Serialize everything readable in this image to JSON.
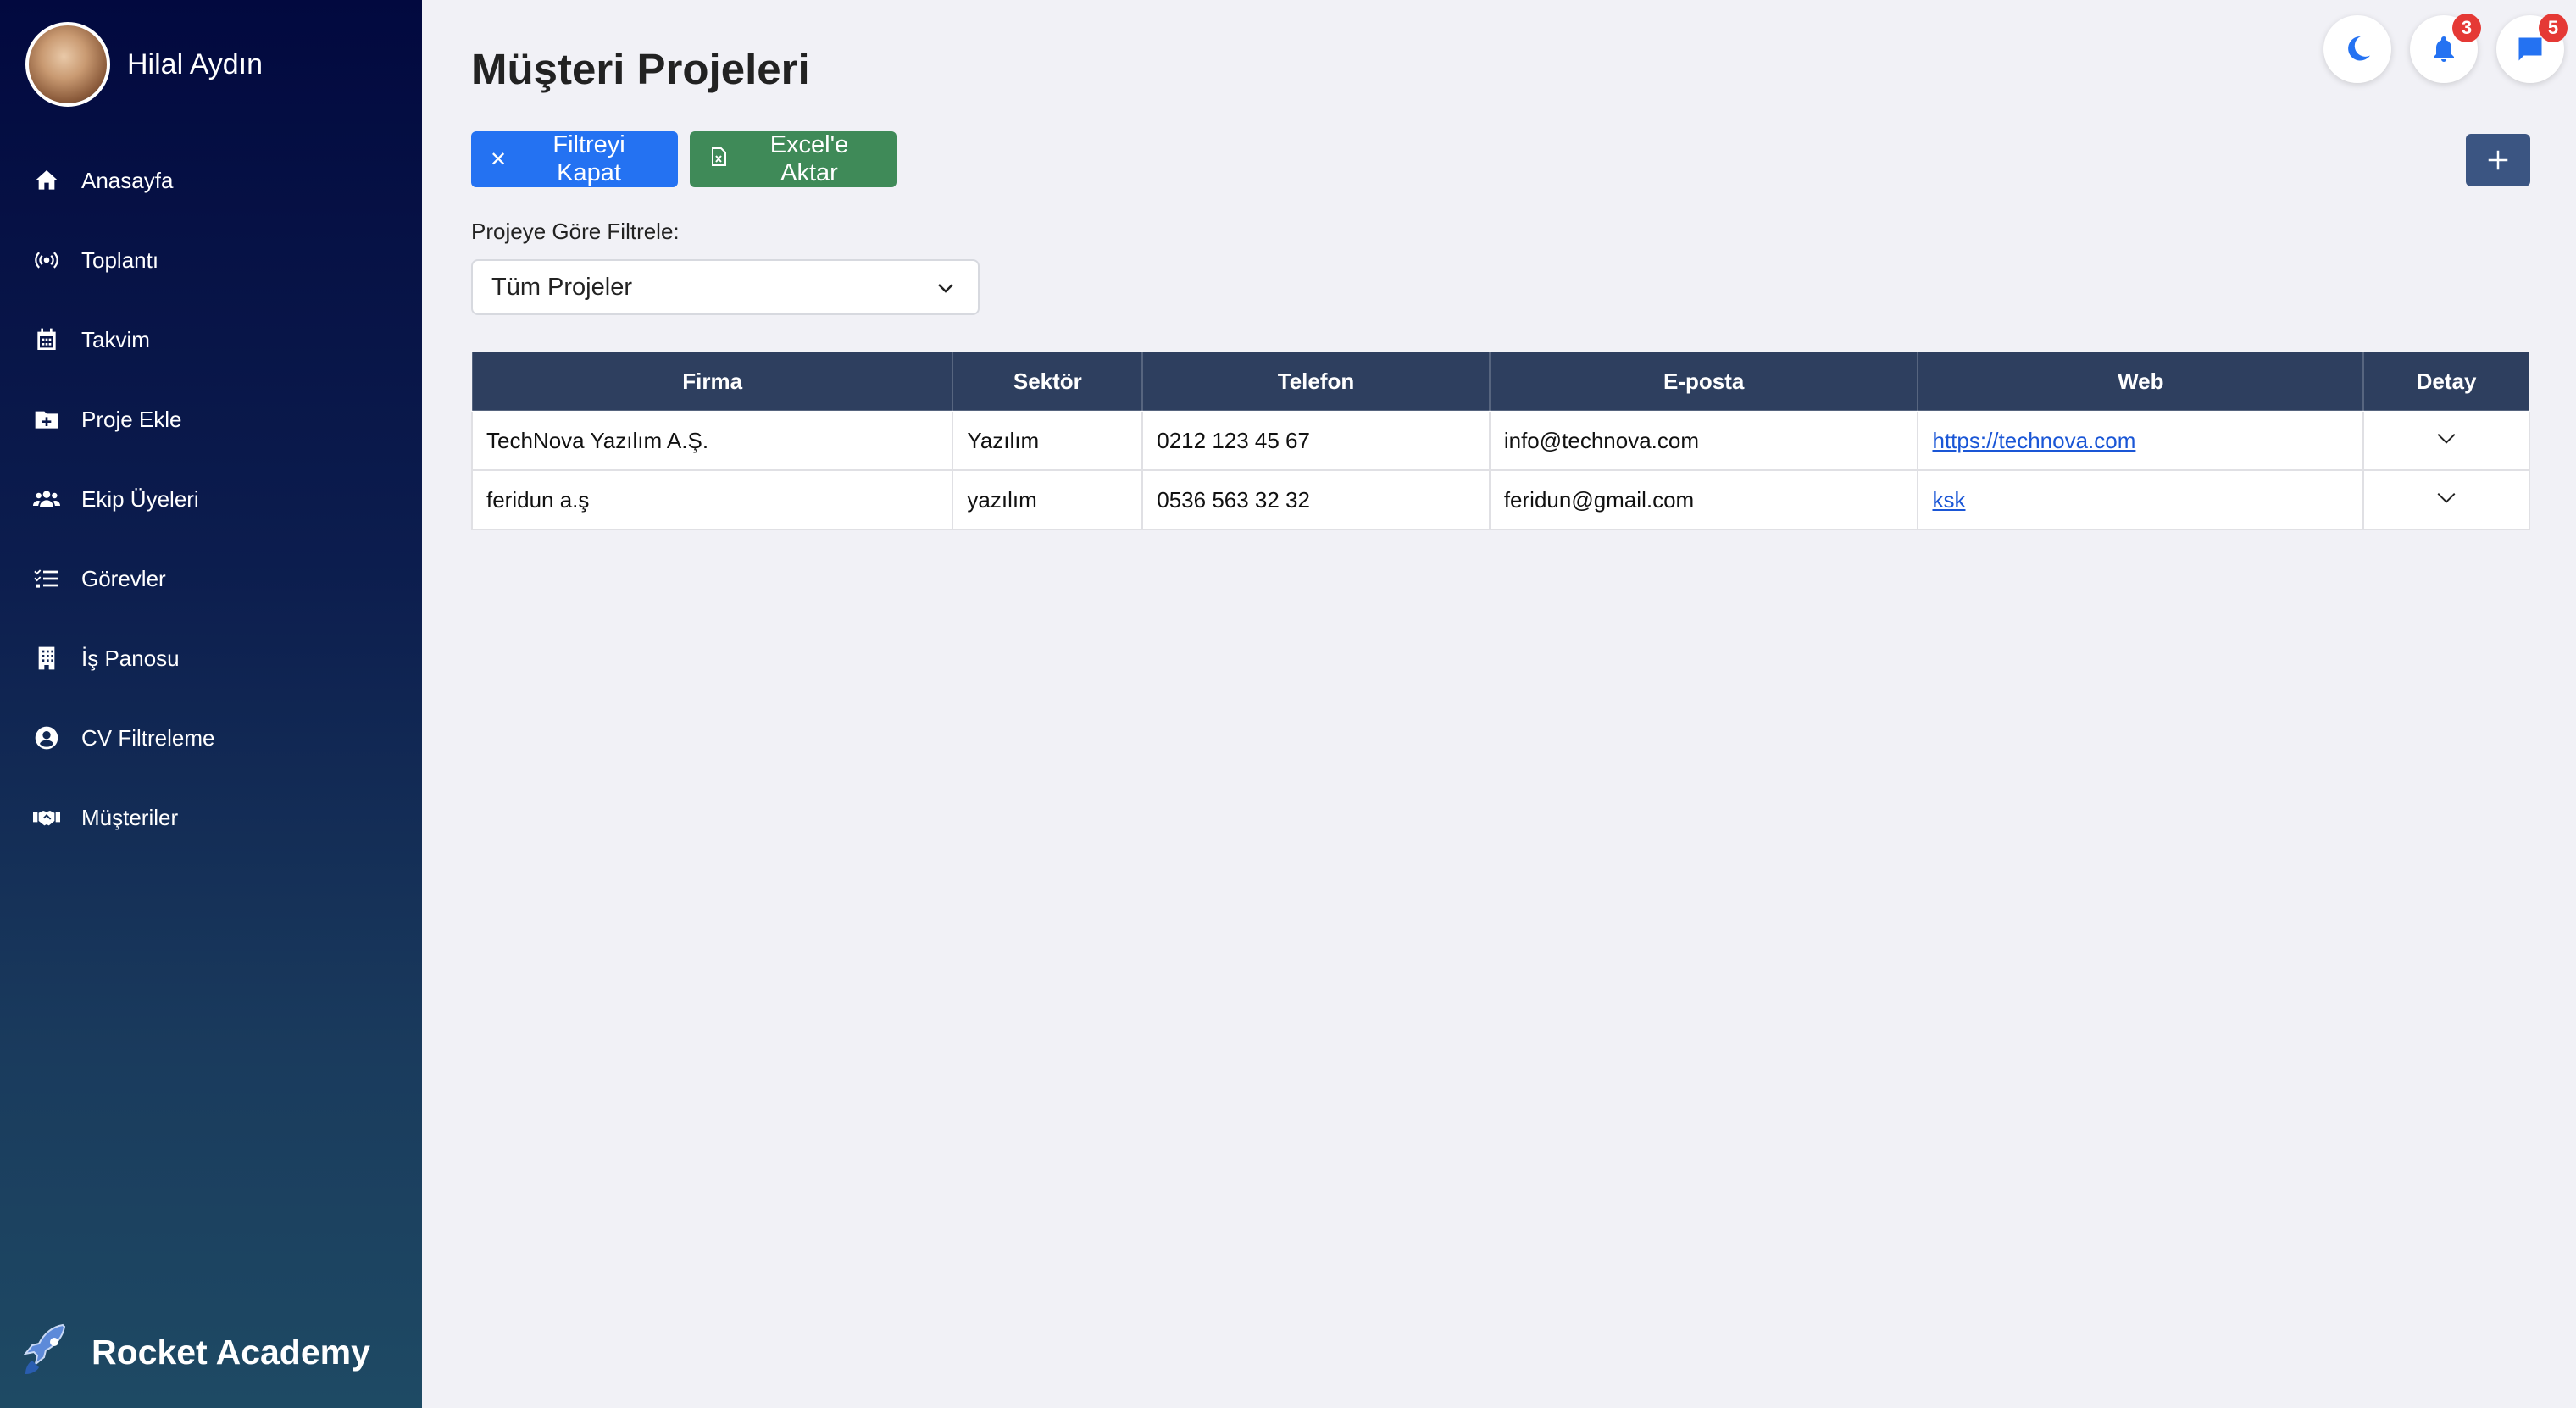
{
  "user": {
    "name": "Hilal Aydın"
  },
  "sidebar": {
    "items": [
      {
        "label": "Anasayfa",
        "icon": "home-icon"
      },
      {
        "label": "Toplantı",
        "icon": "broadcast-icon"
      },
      {
        "label": "Takvim",
        "icon": "calendar-icon"
      },
      {
        "label": "Proje Ekle",
        "icon": "folder-plus-icon"
      },
      {
        "label": "Ekip Üyeleri",
        "icon": "users-icon"
      },
      {
        "label": "Görevler",
        "icon": "tasks-icon"
      },
      {
        "label": "İş Panosu",
        "icon": "building-icon"
      },
      {
        "label": "CV Filtreleme",
        "icon": "user-circle-icon"
      },
      {
        "label": "Müşteriler",
        "icon": "handshake-icon"
      }
    ],
    "brand": "Rocket Academy"
  },
  "header": {
    "title": "Müşteri Projeleri",
    "notifications_count": "3",
    "messages_count": "5"
  },
  "toolbar": {
    "close_filter_label": "Filtreyi Kapat",
    "excel_label": "Excel'e Aktar"
  },
  "filter": {
    "label": "Projeye Göre Filtrele:",
    "selected": "Tüm Projeler"
  },
  "table": {
    "columns": [
      "Firma",
      "Sektör",
      "Telefon",
      "E-posta",
      "Web",
      "Detay"
    ],
    "rows": [
      {
        "firma": "TechNova Yazılım A.Ş.",
        "sektor": "Yazılım",
        "telefon": "0212 123 45 67",
        "eposta": "info@technova.com",
        "web": "https://technova.com"
      },
      {
        "firma": "feridun a.ş",
        "sektor": "yazılım",
        "telefon": "0536 563 32 32",
        "eposta": "feridun@gmail.com",
        "web": "ksk"
      }
    ]
  },
  "colors": {
    "primary": "#2472f2",
    "success": "#3f8a58",
    "table_header": "#2e3f5f",
    "badge": "#e53935"
  }
}
